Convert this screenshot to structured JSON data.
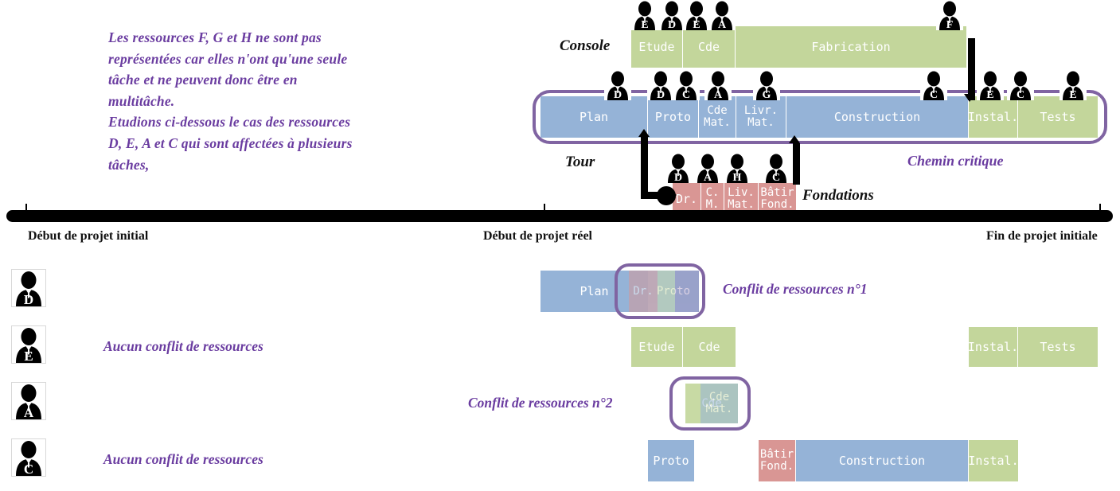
{
  "intro": {
    "lines": [
      "Les ressources F, G et H ne sont pas",
      "représentées car elles n'ont qu'une seule",
      "tâche et ne peuvent donc être en",
      "multitâche.",
      "Etudions ci-dessous le cas des ressources",
      "D, E, A et C qui sont affectées à plusieurs",
      "tâches,"
    ]
  },
  "colors": {
    "green": "#c3d69b",
    "blue": "#95b3d7",
    "pink": "#d99694",
    "purple": "#6a3ca0",
    "outline": "#8064a2",
    "black": "#000000"
  },
  "rows": {
    "console_label": "Console",
    "tour_label": "Tour",
    "fondations_label": "Fondations"
  },
  "gantt": {
    "console_tasks": [
      {
        "label": "Etude",
        "color": "green"
      },
      {
        "label": "Cde",
        "color": "green"
      },
      {
        "label": "Fabrication",
        "color": "green"
      }
    ],
    "console_resources": [
      "E",
      "D",
      "E",
      "A",
      "F"
    ],
    "tour_tasks": [
      {
        "label": "Plan",
        "color": "blue"
      },
      {
        "label": "Proto",
        "color": "blue"
      },
      {
        "label": "Cde\nMat.",
        "color": "blue"
      },
      {
        "label": "Livr.\nMat.",
        "color": "blue"
      },
      {
        "label": "Construction",
        "color": "blue"
      },
      {
        "label": "Instal.",
        "color": "green"
      },
      {
        "label": "Tests",
        "color": "green"
      }
    ],
    "tour_resources": [
      "D",
      "D",
      "C",
      "A",
      "G",
      "C",
      "E",
      "C",
      "E"
    ],
    "fondations_tasks": [
      {
        "label": "Dr.",
        "color": "pink"
      },
      {
        "label": "C.\nM.",
        "color": "pink"
      },
      {
        "label": "Liv.\nMat.",
        "color": "pink"
      },
      {
        "label": "Bâtir\nFond.",
        "color": "pink"
      }
    ],
    "fondations_resources": [
      "D",
      "A",
      "H",
      "C"
    ]
  },
  "critical_path_label": "Chemin critique",
  "timeline": {
    "start_initial": "Début de projet initial",
    "start_real": "Début de projet réel",
    "end_initial": "Fin de projet initiale"
  },
  "resource_rows": [
    {
      "resource": "D",
      "annotation": "Conflit de ressources n°1",
      "has_conflict": true,
      "tasks": [
        {
          "label": "Plan",
          "color": "blue"
        },
        {
          "label": "Proto",
          "color": "blue"
        },
        {
          "label": "Dr.",
          "color": "pink"
        }
      ]
    },
    {
      "resource": "E",
      "annotation": "Aucun conflit de ressources",
      "has_conflict": false,
      "tasks": [
        {
          "label": "Etude",
          "color": "green"
        },
        {
          "label": "Cde",
          "color": "green"
        },
        {
          "label": "Instal.",
          "color": "green"
        },
        {
          "label": "Tests",
          "color": "green"
        }
      ]
    },
    {
      "resource": "A",
      "annotation": "Conflit de ressources n°2",
      "has_conflict": true,
      "tasks": [
        {
          "label": "Cde",
          "color": "green"
        },
        {
          "label": "Cde\nMat.",
          "color": "blue"
        },
        {
          "label": "C.\nM.",
          "color": "pink"
        }
      ]
    },
    {
      "resource": "C",
      "annotation": "Aucun conflit de ressources",
      "has_conflict": false,
      "tasks": [
        {
          "label": "Proto",
          "color": "blue"
        },
        {
          "label": "Bâtir\nFond.",
          "color": "pink"
        },
        {
          "label": "Construction",
          "color": "blue"
        },
        {
          "label": "Instal.",
          "color": "green"
        }
      ]
    }
  ]
}
